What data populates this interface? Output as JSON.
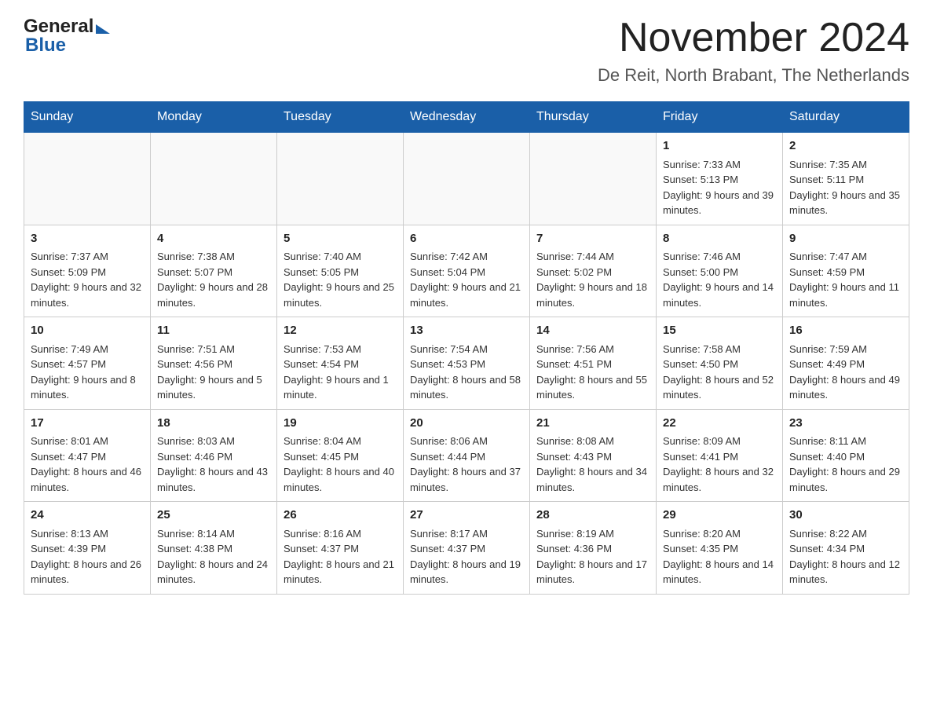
{
  "header": {
    "title": "November 2024",
    "location": "De Reit, North Brabant, The Netherlands",
    "logo_general": "General",
    "logo_blue": "Blue"
  },
  "weekdays": [
    "Sunday",
    "Monday",
    "Tuesday",
    "Wednesday",
    "Thursday",
    "Friday",
    "Saturday"
  ],
  "weeks": [
    {
      "days": [
        {
          "number": "",
          "info": "",
          "empty": true
        },
        {
          "number": "",
          "info": "",
          "empty": true
        },
        {
          "number": "",
          "info": "",
          "empty": true
        },
        {
          "number": "",
          "info": "",
          "empty": true
        },
        {
          "number": "",
          "info": "",
          "empty": true
        },
        {
          "number": "1",
          "info": "Sunrise: 7:33 AM\nSunset: 5:13 PM\nDaylight: 9 hours and 39 minutes."
        },
        {
          "number": "2",
          "info": "Sunrise: 7:35 AM\nSunset: 5:11 PM\nDaylight: 9 hours and 35 minutes."
        }
      ]
    },
    {
      "days": [
        {
          "number": "3",
          "info": "Sunrise: 7:37 AM\nSunset: 5:09 PM\nDaylight: 9 hours and 32 minutes."
        },
        {
          "number": "4",
          "info": "Sunrise: 7:38 AM\nSunset: 5:07 PM\nDaylight: 9 hours and 28 minutes."
        },
        {
          "number": "5",
          "info": "Sunrise: 7:40 AM\nSunset: 5:05 PM\nDaylight: 9 hours and 25 minutes."
        },
        {
          "number": "6",
          "info": "Sunrise: 7:42 AM\nSunset: 5:04 PM\nDaylight: 9 hours and 21 minutes."
        },
        {
          "number": "7",
          "info": "Sunrise: 7:44 AM\nSunset: 5:02 PM\nDaylight: 9 hours and 18 minutes."
        },
        {
          "number": "8",
          "info": "Sunrise: 7:46 AM\nSunset: 5:00 PM\nDaylight: 9 hours and 14 minutes."
        },
        {
          "number": "9",
          "info": "Sunrise: 7:47 AM\nSunset: 4:59 PM\nDaylight: 9 hours and 11 minutes."
        }
      ]
    },
    {
      "days": [
        {
          "number": "10",
          "info": "Sunrise: 7:49 AM\nSunset: 4:57 PM\nDaylight: 9 hours and 8 minutes."
        },
        {
          "number": "11",
          "info": "Sunrise: 7:51 AM\nSunset: 4:56 PM\nDaylight: 9 hours and 5 minutes."
        },
        {
          "number": "12",
          "info": "Sunrise: 7:53 AM\nSunset: 4:54 PM\nDaylight: 9 hours and 1 minute."
        },
        {
          "number": "13",
          "info": "Sunrise: 7:54 AM\nSunset: 4:53 PM\nDaylight: 8 hours and 58 minutes."
        },
        {
          "number": "14",
          "info": "Sunrise: 7:56 AM\nSunset: 4:51 PM\nDaylight: 8 hours and 55 minutes."
        },
        {
          "number": "15",
          "info": "Sunrise: 7:58 AM\nSunset: 4:50 PM\nDaylight: 8 hours and 52 minutes."
        },
        {
          "number": "16",
          "info": "Sunrise: 7:59 AM\nSunset: 4:49 PM\nDaylight: 8 hours and 49 minutes."
        }
      ]
    },
    {
      "days": [
        {
          "number": "17",
          "info": "Sunrise: 8:01 AM\nSunset: 4:47 PM\nDaylight: 8 hours and 46 minutes."
        },
        {
          "number": "18",
          "info": "Sunrise: 8:03 AM\nSunset: 4:46 PM\nDaylight: 8 hours and 43 minutes."
        },
        {
          "number": "19",
          "info": "Sunrise: 8:04 AM\nSunset: 4:45 PM\nDaylight: 8 hours and 40 minutes."
        },
        {
          "number": "20",
          "info": "Sunrise: 8:06 AM\nSunset: 4:44 PM\nDaylight: 8 hours and 37 minutes."
        },
        {
          "number": "21",
          "info": "Sunrise: 8:08 AM\nSunset: 4:43 PM\nDaylight: 8 hours and 34 minutes."
        },
        {
          "number": "22",
          "info": "Sunrise: 8:09 AM\nSunset: 4:41 PM\nDaylight: 8 hours and 32 minutes."
        },
        {
          "number": "23",
          "info": "Sunrise: 8:11 AM\nSunset: 4:40 PM\nDaylight: 8 hours and 29 minutes."
        }
      ]
    },
    {
      "days": [
        {
          "number": "24",
          "info": "Sunrise: 8:13 AM\nSunset: 4:39 PM\nDaylight: 8 hours and 26 minutes."
        },
        {
          "number": "25",
          "info": "Sunrise: 8:14 AM\nSunset: 4:38 PM\nDaylight: 8 hours and 24 minutes."
        },
        {
          "number": "26",
          "info": "Sunrise: 8:16 AM\nSunset: 4:37 PM\nDaylight: 8 hours and 21 minutes."
        },
        {
          "number": "27",
          "info": "Sunrise: 8:17 AM\nSunset: 4:37 PM\nDaylight: 8 hours and 19 minutes."
        },
        {
          "number": "28",
          "info": "Sunrise: 8:19 AM\nSunset: 4:36 PM\nDaylight: 8 hours and 17 minutes."
        },
        {
          "number": "29",
          "info": "Sunrise: 8:20 AM\nSunset: 4:35 PM\nDaylight: 8 hours and 14 minutes."
        },
        {
          "number": "30",
          "info": "Sunrise: 8:22 AM\nSunset: 4:34 PM\nDaylight: 8 hours and 12 minutes."
        }
      ]
    }
  ]
}
